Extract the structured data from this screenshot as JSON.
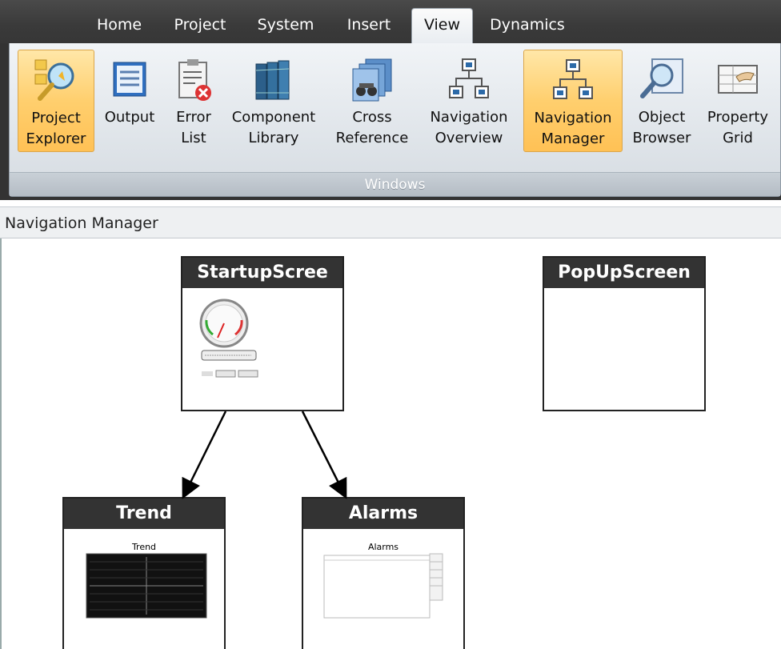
{
  "tabs": [
    {
      "label": "Home"
    },
    {
      "label": "Project"
    },
    {
      "label": "System"
    },
    {
      "label": "Insert"
    },
    {
      "label": "View",
      "active": true
    },
    {
      "label": "Dynamics"
    }
  ],
  "ribbon": {
    "group_label": "Windows",
    "buttons": [
      {
        "label": "Project\nExplorer",
        "icon": "project-explorer-icon",
        "selected": true
      },
      {
        "label": "Output",
        "icon": "output-icon"
      },
      {
        "label": "Error\nList",
        "icon": "error-list-icon"
      },
      {
        "label": "Component\nLibrary",
        "icon": "component-library-icon"
      },
      {
        "label": "Cross\nReference",
        "icon": "cross-reference-icon"
      },
      {
        "label": "Navigation\nOverview",
        "icon": "navigation-overview-icon"
      },
      {
        "label": "Navigation\nManager",
        "icon": "navigation-manager-icon",
        "selected": true
      },
      {
        "label": "Object\nBrowser",
        "icon": "object-browser-icon"
      },
      {
        "label": "Property\nGrid",
        "icon": "property-grid-icon"
      }
    ]
  },
  "panel": {
    "title": "Navigation Manager"
  },
  "nodes": {
    "startup": {
      "title": "StartupScree"
    },
    "popup": {
      "title": "PopUpScreen"
    },
    "trend": {
      "title": "Trend",
      "thumb_caption": "Trend"
    },
    "alarms": {
      "title": "Alarms",
      "thumb_caption": "Alarms"
    }
  },
  "colors": {
    "ribbon_selected": "#ffcf6e",
    "node_header": "#333333",
    "tab_bar": "#3d3d3d"
  }
}
